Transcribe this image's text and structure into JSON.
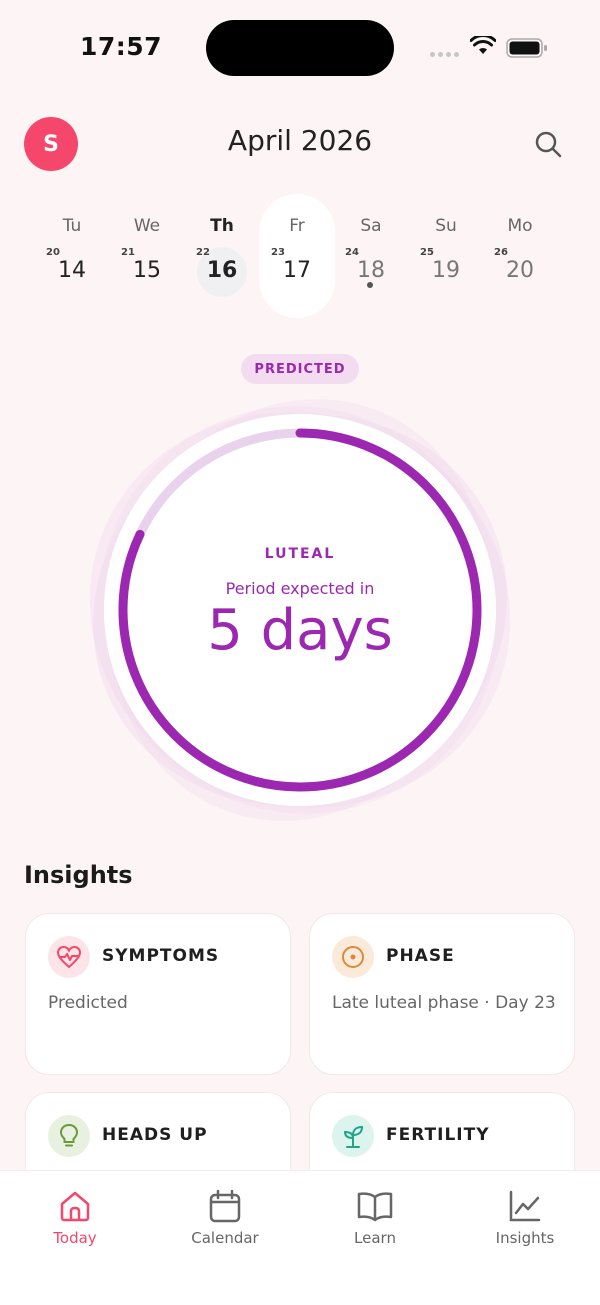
{
  "status_bar": {
    "time": "17:57"
  },
  "header": {
    "avatar_initial": "S",
    "month_title": "April 2026"
  },
  "week": [
    {
      "name": "Tu",
      "small": "20",
      "num": "14"
    },
    {
      "name": "We",
      "small": "21",
      "num": "15"
    },
    {
      "name": "Th",
      "small": "22",
      "num": "16"
    },
    {
      "name": "Fr",
      "small": "23",
      "num": "17"
    },
    {
      "name": "Sa",
      "small": "24",
      "num": "18"
    },
    {
      "name": "Su",
      "small": "25",
      "num": "19"
    },
    {
      "name": "Mo",
      "small": "26",
      "num": "20"
    }
  ],
  "cycle": {
    "badge": "PREDICTED",
    "phase": "LUTEAL",
    "expected_label": "Period expected in",
    "days_value": "5 days",
    "progress_fraction": 0.82
  },
  "insights": {
    "title": "Insights",
    "cards": [
      {
        "title": "SYMPTOMS",
        "body": "Predicted",
        "icon": "heart-pulse-icon"
      },
      {
        "title": "PHASE",
        "body": "Late luteal phase · Day 23",
        "icon": "phase-circle-icon"
      },
      {
        "title": "HEADS UP",
        "body": "",
        "icon": "lightbulb-icon"
      },
      {
        "title": "FERTILITY",
        "body": "",
        "icon": "sprout-icon"
      }
    ]
  },
  "nav": [
    {
      "label": "Today",
      "icon": "home-icon"
    },
    {
      "label": "Calendar",
      "icon": "calendar-icon"
    },
    {
      "label": "Learn",
      "icon": "book-icon"
    },
    {
      "label": "Insights",
      "icon": "chart-icon"
    }
  ],
  "colors": {
    "accent": "#f4476b",
    "phase_purple": "#9c27b0",
    "background": "#fdf5f5"
  }
}
